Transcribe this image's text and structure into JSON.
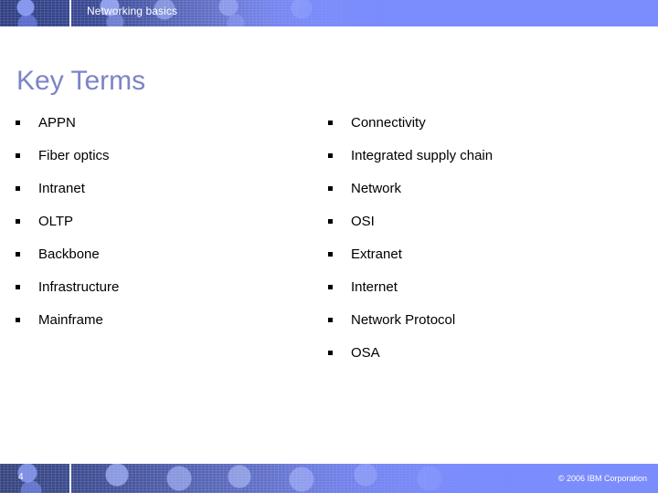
{
  "header": {
    "title": "Networking basics"
  },
  "title": "Key Terms",
  "columns": {
    "left": [
      {
        "label": "APPN"
      },
      {
        "label": "Fiber optics"
      },
      {
        "label": "Intranet"
      },
      {
        "label": "OLTP"
      },
      {
        "label": "Backbone"
      },
      {
        "label": "Infrastructure"
      },
      {
        "label": "Mainframe"
      }
    ],
    "right": [
      {
        "label": "Connectivity"
      },
      {
        "label": "Integrated supply chain"
      },
      {
        "label": "Network"
      },
      {
        "label": "OSI"
      },
      {
        "label": "Extranet"
      },
      {
        "label": "Internet"
      },
      {
        "label": "Network Protocol"
      },
      {
        "label": "OSA"
      }
    ]
  },
  "footer": {
    "slide_number": "4",
    "copyright": "© 2006 IBM Corporation"
  },
  "colors": {
    "band": "#7b8cfc",
    "band_dark": "#2f3f80",
    "title": "#7b84c8",
    "text": "#000000",
    "band_text": "#ffffff"
  }
}
